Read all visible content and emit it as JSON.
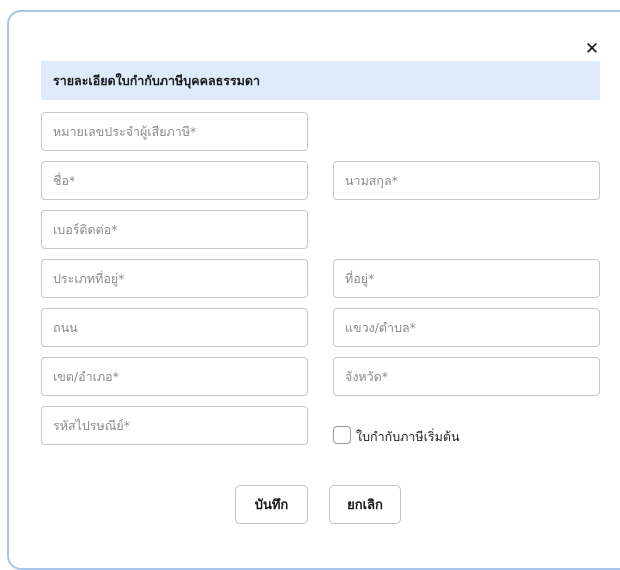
{
  "dialog": {
    "close_symbol": "✕",
    "close_icon": "close-icon"
  },
  "section": {
    "title": "รายละเอียดใบกำกับภาษีบุคคลธรรมดา"
  },
  "fields": {
    "tax_id": {
      "placeholder": "หมายเลขประจำผู้เสียภาษี*",
      "value": ""
    },
    "first_name": {
      "placeholder": "ชื่อ*",
      "value": ""
    },
    "last_name": {
      "placeholder": "นามสกุล*",
      "value": ""
    },
    "phone": {
      "placeholder": "เบอร์ติดต่อ*",
      "value": ""
    },
    "address_type": {
      "placeholder": "ประเภทที่อยู่*",
      "value": ""
    },
    "address": {
      "placeholder": "ที่อยู่*",
      "value": ""
    },
    "road": {
      "placeholder": "ถนน",
      "value": ""
    },
    "subdistrict": {
      "placeholder": "แขวง/ตำบล*",
      "value": ""
    },
    "district": {
      "placeholder": "เขต/อำเภอ*",
      "value": ""
    },
    "province": {
      "placeholder": "จังหวัด*",
      "value": ""
    },
    "postal_code": {
      "placeholder": "รหัสไปรษณีย์*",
      "value": ""
    }
  },
  "default_invoice": {
    "label": "ใบกำกับภาษีเริ่มต้น",
    "checked": false
  },
  "actions": {
    "save_label": "บันทึก",
    "cancel_label": "ยกเลิก"
  }
}
